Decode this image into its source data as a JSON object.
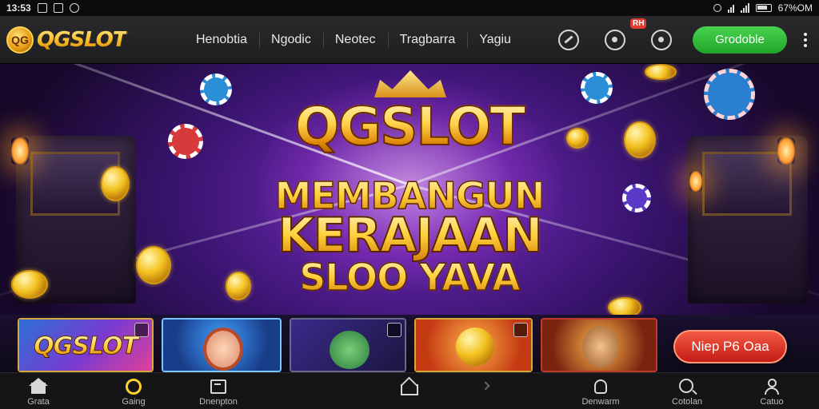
{
  "status_bar": {
    "time": "13:53",
    "battery_text": "67%OM"
  },
  "brand": {
    "logo_text": "QG",
    "name": "QGSLOT"
  },
  "nav": {
    "links": [
      "Henobtia",
      "Ngodic",
      "Neotec",
      "Tragbarra",
      "Yagiu"
    ],
    "notification_badge": "RH",
    "cta_label": "Grodoble"
  },
  "hero": {
    "title": "QGSLOT",
    "line1": "MEMBANGUN",
    "line2": "KERAJAAN",
    "line3": "SLOO YAVA"
  },
  "game_strip": {
    "card1_label": "QGSLOT",
    "promo_label": "Niep P6 Oaa"
  },
  "bottom_nav": {
    "items": [
      {
        "label": "Grata",
        "icon": "home-icon"
      },
      {
        "label": "Gaing",
        "icon": "coin-ring-icon"
      },
      {
        "label": "Dnenpton",
        "icon": "box-icon"
      },
      {
        "label": "",
        "icon": "home-outline-icon"
      },
      {
        "label": "",
        "icon": "chevron-right-icon"
      },
      {
        "label": "Denwarm",
        "icon": "hand-icon"
      },
      {
        "label": "Cotolan",
        "icon": "search-icon"
      },
      {
        "label": "Catuo",
        "icon": "person-icon"
      }
    ]
  },
  "colors": {
    "cta_green": "#21a52a",
    "promo_red": "#c41c14",
    "gold": "#ffcf3a",
    "hero_purple": "#7a2ec2"
  }
}
